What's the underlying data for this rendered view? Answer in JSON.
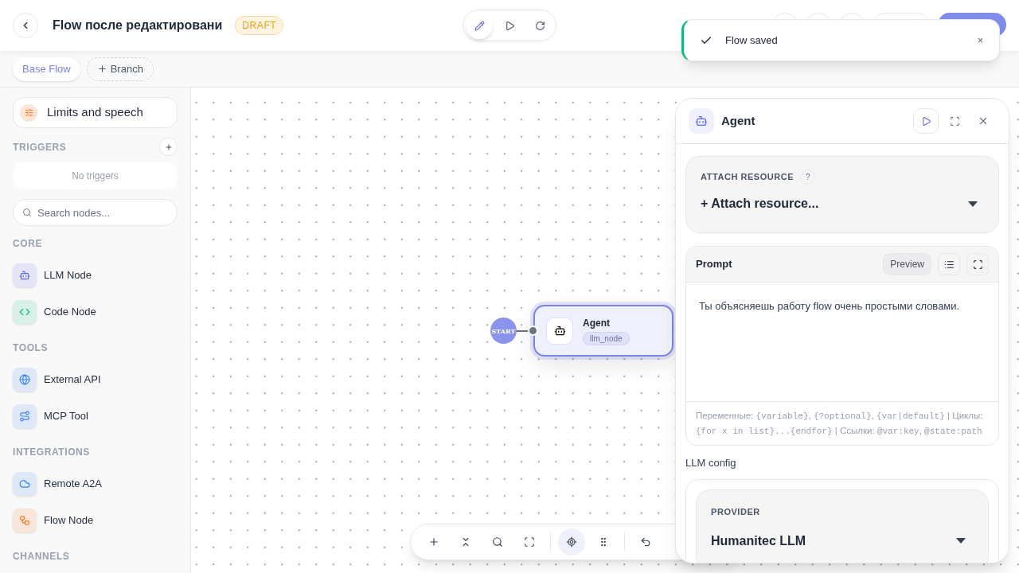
{
  "header": {
    "title": "Flow после редактировани",
    "badge": "DRAFT",
    "modes": [
      {
        "kind": "edit",
        "selected": true
      },
      {
        "kind": "run",
        "selected": false
      },
      {
        "kind": "refresh",
        "selected": false
      }
    ]
  },
  "tabs": [
    {
      "kind": "branch",
      "label": "Base Flow",
      "selected": true
    },
    {
      "kind": "add",
      "label": "Branch",
      "selected": false
    }
  ],
  "toast": {
    "message": "Flow saved",
    "close": "×"
  },
  "sidebar": {
    "limits": "Limits and speech",
    "triggers": {
      "title": "TRIGGERS",
      "empty": "No triggers"
    },
    "search": {
      "placeholder": "Search nodes..."
    },
    "groups": [
      {
        "title": "CORE",
        "items": [
          {
            "label": "LLM Node",
            "kind": "robot",
            "color": "#6366f1"
          },
          {
            "label": "Code Node",
            "kind": "code",
            "color": "#10b981"
          }
        ]
      },
      {
        "title": "TOOLS",
        "items": [
          {
            "label": "External API",
            "kind": "globe",
            "color": "#3b82f6"
          },
          {
            "label": "MCP Tool",
            "kind": "route",
            "color": "#3b82f6"
          }
        ]
      },
      {
        "title": "INTEGRATIONS",
        "items": [
          {
            "label": "Remote A2A",
            "kind": "cloud",
            "color": "#3b82f6"
          },
          {
            "label": "Flow Node",
            "kind": "flow",
            "color": "#f97316"
          }
        ]
      },
      {
        "title": "CHANNELS"
      }
    ]
  },
  "canvas": {
    "start": "START",
    "node": {
      "title": "Agent",
      "tag": "llm_node",
      "selected": true
    },
    "tools": [
      {
        "kind": "add",
        "selected": false
      },
      {
        "kind": "collapse",
        "selected": false
      },
      {
        "kind": "search",
        "selected": false
      },
      {
        "kind": "fit",
        "selected": false
      },
      {
        "kind": "locate",
        "selected": true
      },
      {
        "kind": "grid",
        "selected": false
      },
      {
        "kind": "undo",
        "selected": false
      }
    ]
  },
  "panel": {
    "title": "Agent",
    "attach": {
      "label": "ATTACH RESOURCE",
      "help": "?",
      "value": "+ Attach resource..."
    },
    "prompt": {
      "title": "Prompt",
      "preview": "Preview",
      "text": "Ты объясняешь работу flow очень простыми словами.",
      "hint": [
        {
          "text": "Переменные: ",
          "code": false
        },
        {
          "text": "{variable}",
          "code": true
        },
        {
          "text": ", ",
          "code": false
        },
        {
          "text": "{?optional}",
          "code": true
        },
        {
          "text": ", ",
          "code": false
        },
        {
          "text": "{var|default}",
          "code": true
        },
        {
          "text": " | Циклы: ",
          "code": false
        },
        {
          "text": "{for x in list}...{endfor}",
          "code": true
        },
        {
          "text": " | Ссылки: ",
          "code": false
        },
        {
          "text": "@var:key",
          "code": true
        },
        {
          "text": ", ",
          "code": false
        },
        {
          "text": "@state:path",
          "code": true
        }
      ]
    },
    "llm": {
      "title": "LLM config",
      "provider_label": "PROVIDER",
      "provider": "Humanitec LLM"
    }
  }
}
